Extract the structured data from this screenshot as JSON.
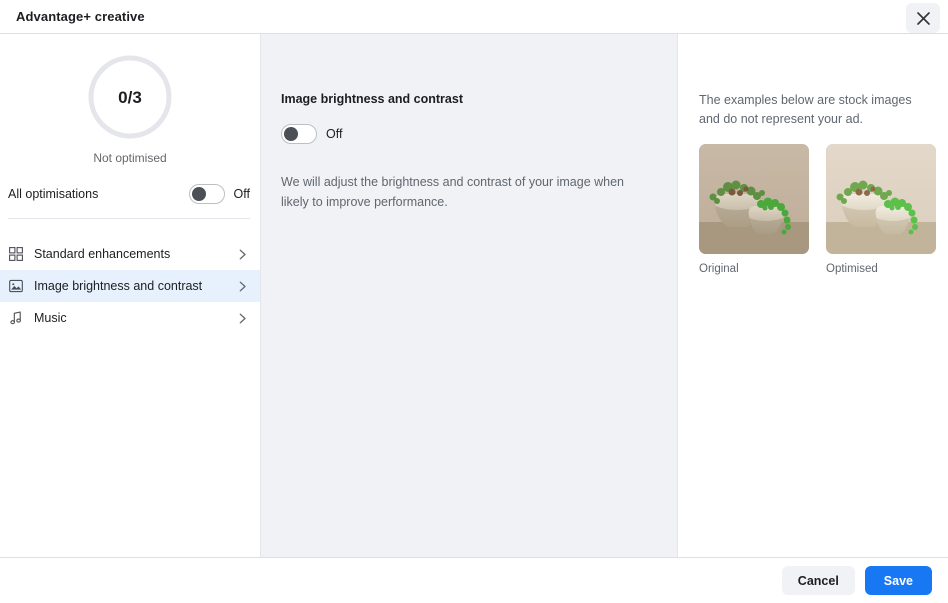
{
  "header": {
    "title": "Advantage+ creative",
    "close_icon": "close-icon"
  },
  "sidebar": {
    "progress": {
      "value": "0/3",
      "completed": 0,
      "total": 3,
      "caption": "Not optimised",
      "ring_track_color": "#e4e6eb",
      "ring_fill_color": "#1877f2"
    },
    "all_optimisations": {
      "label": "All optimisations",
      "toggle_state": "Off",
      "toggle_on": false
    },
    "items": [
      {
        "label": "Standard enhancements",
        "icon": "grid-squares-icon",
        "selected": false,
        "chevron": "chevron-right-icon"
      },
      {
        "label": "Image brightness and contrast",
        "icon": "image-photo-icon",
        "selected": true,
        "chevron": "chevron-right-icon"
      },
      {
        "label": "Music",
        "icon": "music-note-icon",
        "selected": false,
        "chevron": "chevron-right-icon"
      }
    ],
    "selected_color": "#e7f0fd"
  },
  "middle": {
    "title": "Image brightness and contrast",
    "toggle_state": "Off",
    "toggle_on": false,
    "description": "We will adjust the brightness and contrast of your image when likely to improve performance."
  },
  "right": {
    "note": "The examples below are stock images and do not represent your ad.",
    "examples": [
      {
        "caption": "Original",
        "variant": "original"
      },
      {
        "caption": "Optimised",
        "variant": "optimised"
      }
    ]
  },
  "footer": {
    "cancel_label": "Cancel",
    "save_label": "Save",
    "primary_color": "#1877f2"
  }
}
